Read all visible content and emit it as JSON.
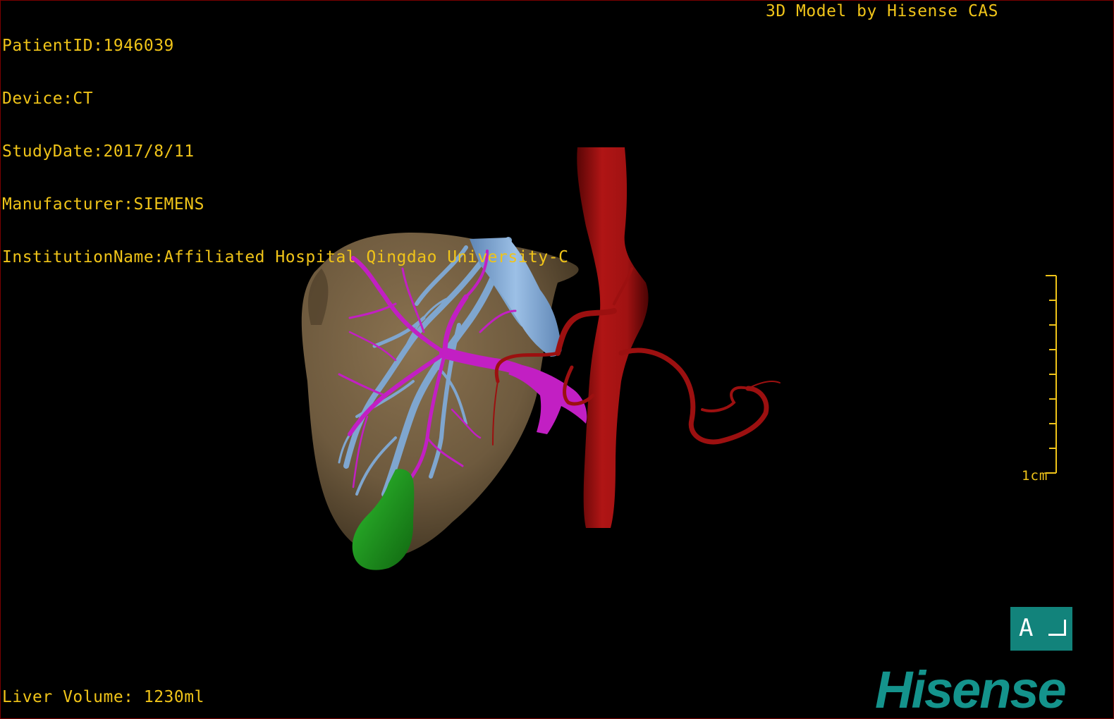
{
  "header": {
    "patient_id": "PatientID:1946039",
    "device": "Device:CT",
    "study_date": "StudyDate:2017/8/11",
    "manufacturer": "Manufacturer:SIEMENS",
    "institution": "InstitutionName:Affiliated Hospital Qingdao University-C"
  },
  "credit": "3D Model by Hisense CAS",
  "footer": {
    "volume": "Liver Volume: 1230ml"
  },
  "scale_bar": {
    "label": "1cm"
  },
  "orientation": {
    "label": "A"
  },
  "brand": {
    "name": "Hisense"
  },
  "colors": {
    "overlay_text": "#f0c419",
    "liver": "#7a6445",
    "hepatic_vein": "#7fa6cf",
    "portal_vein": "#c21fc3",
    "artery": "#9c1010",
    "gallbladder": "#1e9b1e",
    "brand": "#14938c",
    "orientation_box": "#12837b"
  },
  "icons": {
    "orientation_marker": "orientation-cube-icon"
  }
}
